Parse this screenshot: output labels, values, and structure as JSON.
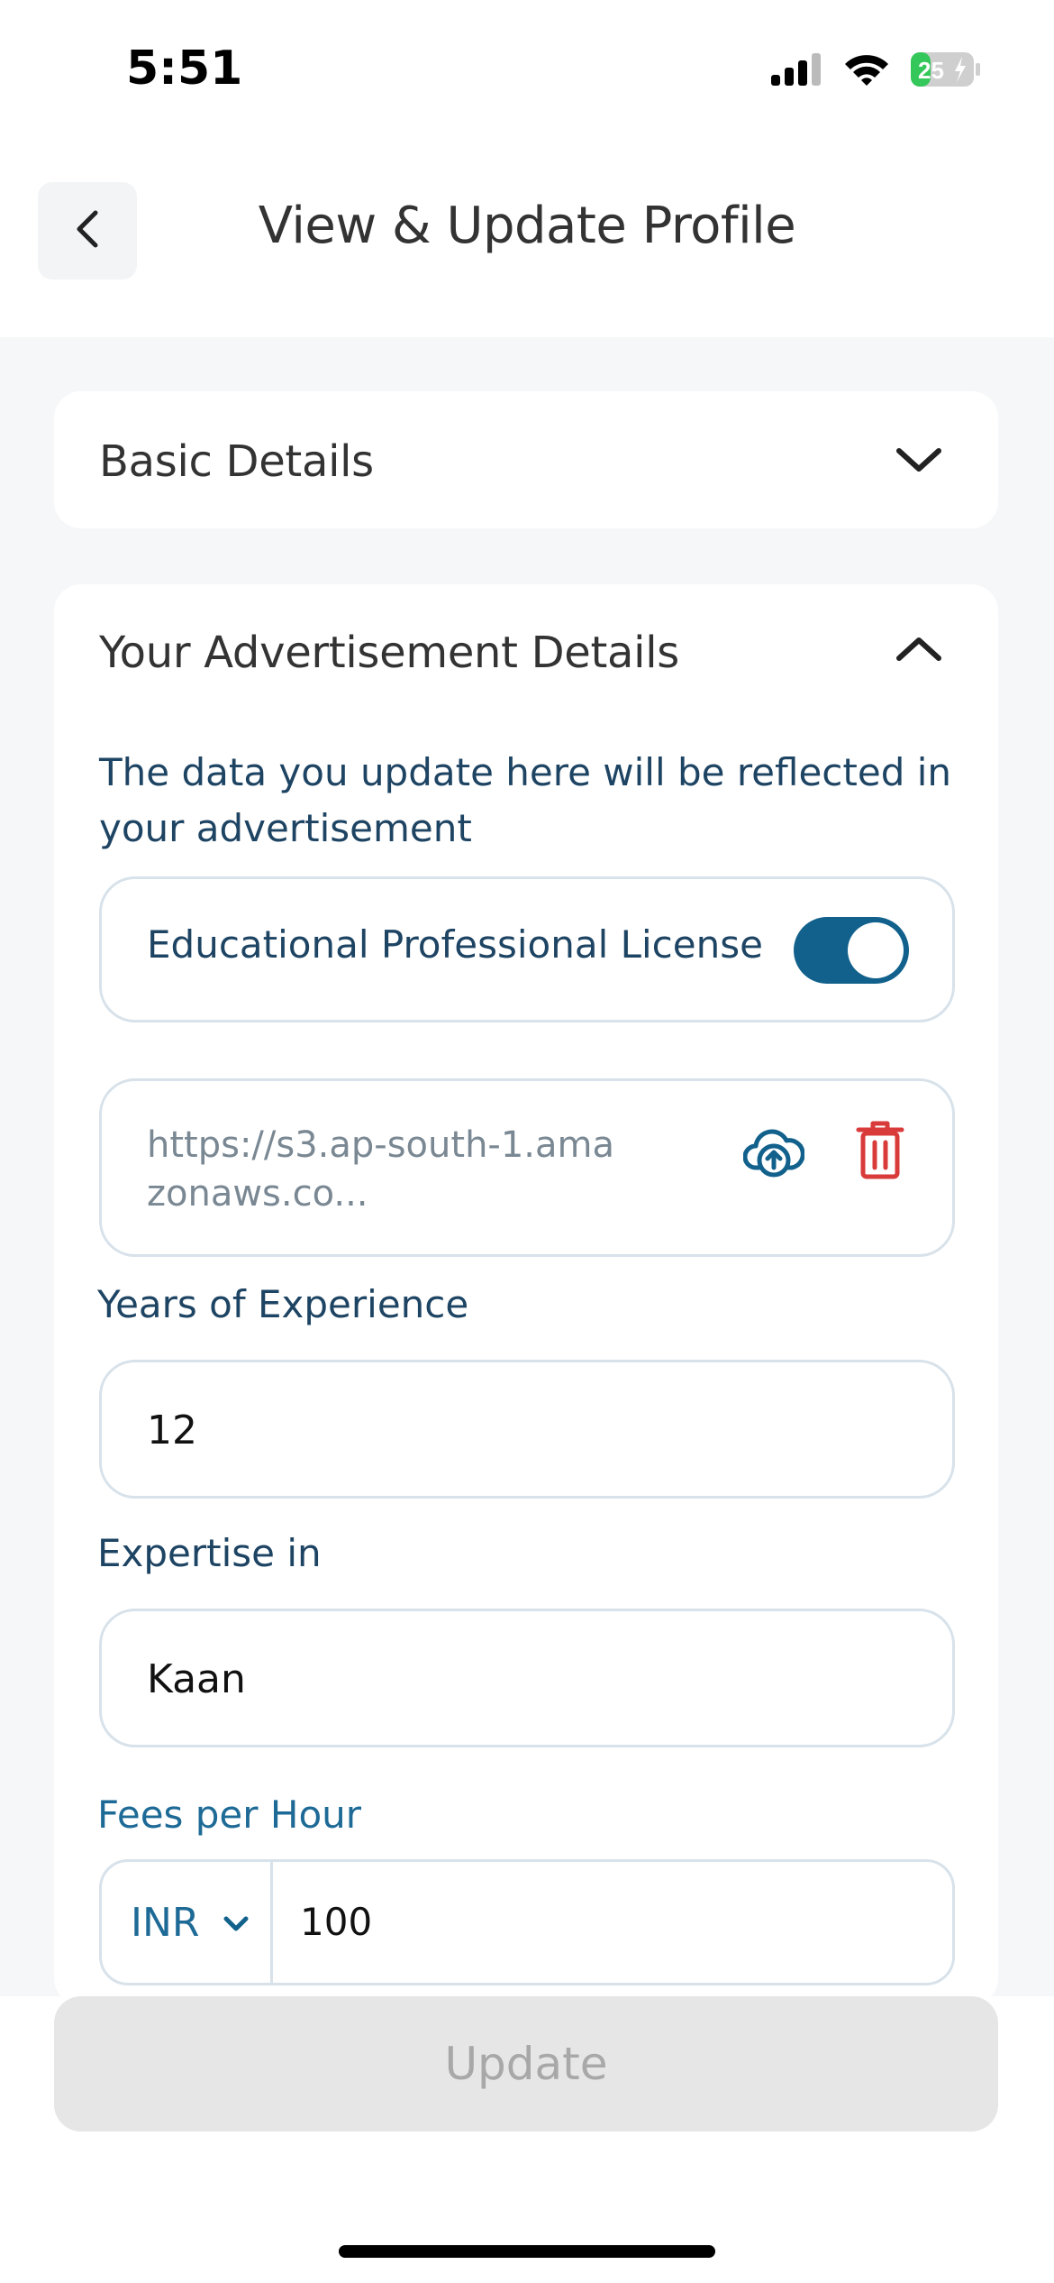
{
  "status_bar": {
    "time": "5:51",
    "battery": "25",
    "icons": [
      "signal-icon",
      "wifi-icon",
      "battery-charging-icon"
    ]
  },
  "header": {
    "title": "View & Update Profile",
    "back_icon": "chevron-left-icon"
  },
  "basic_details": {
    "title": "Basic Details",
    "expanded": false,
    "icon": "chevron-down-icon"
  },
  "advertisement": {
    "title": "Your Advertisement Details",
    "expanded": true,
    "icon": "chevron-up-icon",
    "note": "The data you update here will be reflected in your advertisement",
    "license": {
      "label": "Educational Professional License",
      "enabled": true
    },
    "file": {
      "url": "https://s3.ap-south-1.amazonaws.co...",
      "upload_icon": "cloud-upload-icon",
      "delete_icon": "trash-icon"
    },
    "years": {
      "label": "Years of Experience",
      "value": "12"
    },
    "expertise": {
      "label": "Expertise in",
      "value": "Kaan"
    },
    "fees": {
      "label": "Fees per Hour",
      "currency": "INR",
      "value": "100"
    }
  },
  "footer": {
    "update_label": "Update"
  },
  "colors": {
    "accent": "#12618c",
    "text_primary": "#1e4463",
    "delete": "#d93a3a",
    "button_disabled": "#e6e6e6"
  }
}
